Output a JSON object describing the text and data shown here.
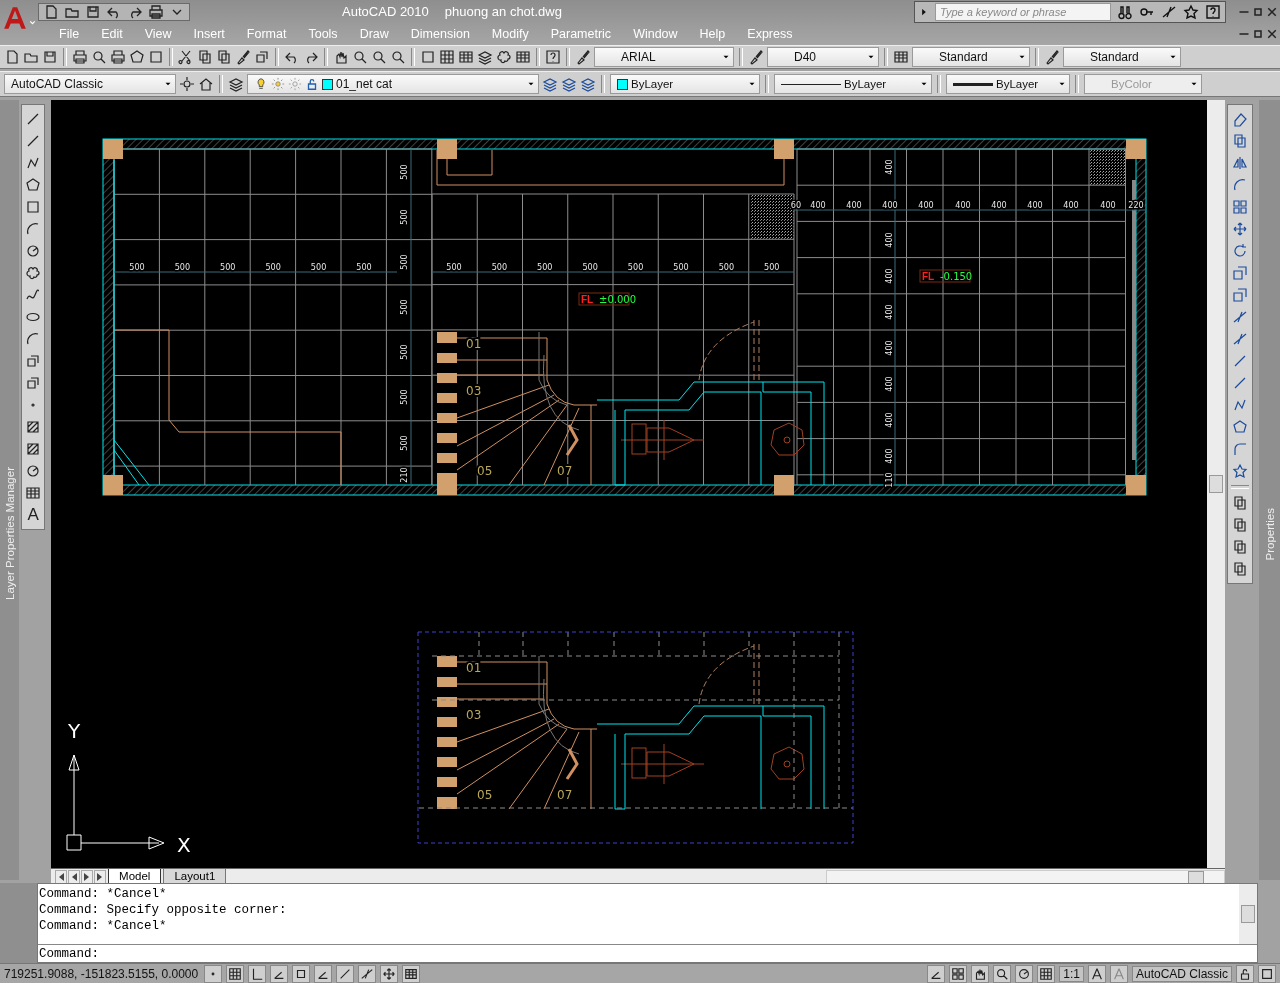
{
  "window": {
    "app_title": "AutoCAD 2010",
    "file_name": "phuong an chot.dwg"
  },
  "search": {
    "placeholder": "Type a keyword or phrase"
  },
  "menu": [
    "File",
    "Edit",
    "View",
    "Insert",
    "Format",
    "Tools",
    "Draw",
    "Dimension",
    "Modify",
    "Parametric",
    "Window",
    "Help",
    "Express"
  ],
  "styles_toolbar": {
    "text_style": "ARIAL",
    "dimension_style": "D40",
    "table_style": "Standard",
    "multileader_style": "Standard"
  },
  "workspace": "AutoCAD Classic",
  "layer": {
    "name": "01_net cat",
    "color": "#00ffff"
  },
  "properties_toolbar": {
    "color_label": "ByLayer",
    "color": "#00ffff",
    "linetype": "ByLayer",
    "lineweight": "ByLayer",
    "plot_style": "ByColor",
    "plot_style_disabled": true
  },
  "left_palette": "Layer Properties Manager",
  "right_palette": "Properties",
  "draw_toolbar": {
    "text_tool": "A"
  },
  "drawing": {
    "dims_left_horizontal": [
      "500",
      "500",
      "500",
      "500",
      "500",
      "500"
    ],
    "dims_middle_horizontal": [
      "500",
      "500",
      "500",
      "500",
      "500",
      "500",
      "500",
      "500"
    ],
    "dims_left_vertical": [
      "500",
      "500",
      "500",
      "500",
      "500",
      "500",
      "500",
      "210"
    ],
    "dims_right_horizontal": [
      "60",
      "400",
      "400",
      "400",
      "400",
      "400",
      "400",
      "400",
      "400",
      "400",
      "220"
    ],
    "dims_right_vertical": [
      "400",
      "400",
      "400",
      "400",
      "400",
      "400",
      "400",
      "400",
      "110"
    ],
    "level_marks": [
      {
        "tag": "FL",
        "value": "±0.000"
      },
      {
        "tag": "FL",
        "value": "-0.150"
      }
    ],
    "stair_labels": [
      "01",
      "03",
      "05",
      "07"
    ],
    "detail_stair_labels": [
      "01",
      "03",
      "05",
      "07"
    ]
  },
  "ucs_icon": {
    "y_label": "Y",
    "x_label": "X"
  },
  "layout_tabs": [
    {
      "label": "Model",
      "selected": true
    },
    {
      "label": "Layout1",
      "selected": false
    }
  ],
  "command_history": [
    "Command: *Cancel*",
    "Command: Specify opposite corner:",
    "Command: *Cancel*"
  ],
  "command_prompt": "Command:",
  "status_bar": {
    "coordinates": "719251.9088, -151823.5155, 0.0000",
    "annotation_scale": "1:1",
    "workspace": "AutoCAD Classic"
  }
}
